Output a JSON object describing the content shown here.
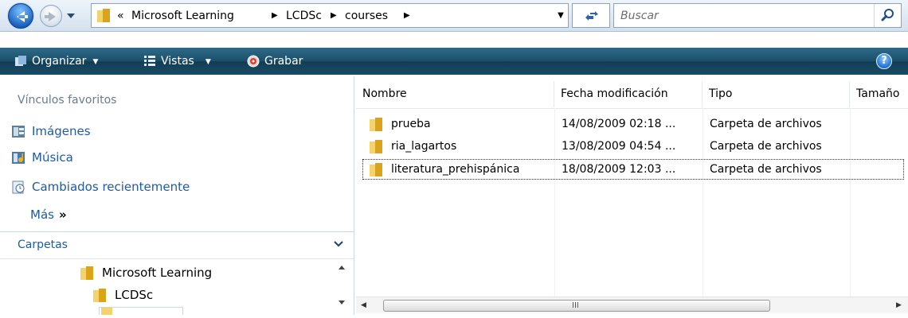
{
  "address": {
    "overflow": "«",
    "crumbs": [
      "Microsoft Learning",
      "LCDSc",
      "courses"
    ],
    "separator": "▶"
  },
  "search": {
    "placeholder": "Buscar"
  },
  "toolbar": {
    "organize_label": "Organizar",
    "views_label": "Vistas",
    "burn_label": "Grabar",
    "help_label": "?"
  },
  "nav": {
    "favorites_title": "Vínculos favoritos",
    "favorites": [
      {
        "label": "Imágenes",
        "icon": "pictures-icon"
      },
      {
        "label": "Música",
        "icon": "music-icon"
      },
      {
        "label": "Cambiados recientemente",
        "icon": "recent-icon"
      }
    ],
    "more_label": "Más",
    "more_arrows": "»",
    "folders_title": "Carpetas",
    "tree": [
      {
        "label": "Microsoft Learning"
      },
      {
        "label": "LCDSc"
      }
    ]
  },
  "list": {
    "columns": [
      "Nombre",
      "Fecha modificación",
      "Tipo",
      "Tamaño"
    ],
    "rows": [
      {
        "name": "prueba",
        "date": "14/08/2009 02:18 ...",
        "type": "Carpeta de archivos",
        "size": ""
      },
      {
        "name": "ria_lagartos",
        "date": "13/08/2009 04:54 ...",
        "type": "Carpeta de archivos",
        "size": ""
      },
      {
        "name": "literatura_prehispánica",
        "date": "18/08/2009 12:03 ...",
        "type": "Carpeta de archivos",
        "size": ""
      }
    ],
    "scroll_grip": "III"
  },
  "colors": {
    "accent_link": "#1e5aa8",
    "command_bar": "#1b4f6a",
    "folder": "#e8b62c"
  }
}
